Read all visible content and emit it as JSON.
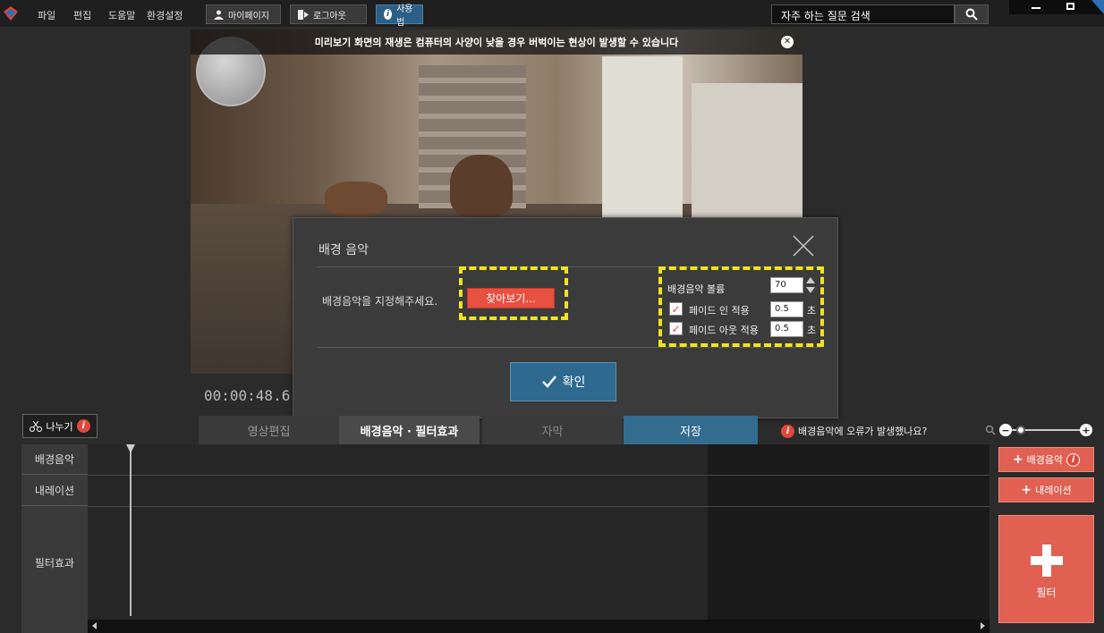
{
  "menu": [
    "파일",
    "편집",
    "도움말",
    "환경설정"
  ],
  "toolbar": {
    "mypage": "마이페이지",
    "logout": "로그아웃",
    "usage": "사용법"
  },
  "search": {
    "placeholder": "자주 하는 질문 검색"
  },
  "preview": {
    "banner": "미리보기 화면의 재생은 컴퓨터의 사양이 낮을 경우 버벅이는 현상이 발생할 수 있습니다",
    "timecode": "00:00:48.6"
  },
  "dialog": {
    "title": "배경 음악",
    "prompt": "배경음악을 지정해주세요.",
    "find_button": "찾아보기...",
    "volume_label": "배경음악 볼륨",
    "volume_value": "70",
    "fade_in_label": "페이드 인 적용",
    "fade_in_value": "0.5",
    "fade_in_checked": true,
    "fade_out_label": "페이드 아웃 적용",
    "fade_out_value": "0.5",
    "fade_out_checked": true,
    "unit": "초",
    "ok_button": "확인"
  },
  "split_button": "나누기",
  "tabs": [
    "영상편집",
    "배경음악 · 필터효과",
    "자막",
    "저장"
  ],
  "error_link": "배경음악에 오류가 발생했나요?",
  "tracks": [
    "배경음악",
    "내레이션",
    "필터효과"
  ],
  "add_buttons": {
    "bgm": "배경음악",
    "narration": "내레이션",
    "filter": "필터"
  },
  "colors": {
    "accent_red": "#e06051",
    "accent_blue": "#336c8f",
    "highlight": "#f1e31e"
  }
}
